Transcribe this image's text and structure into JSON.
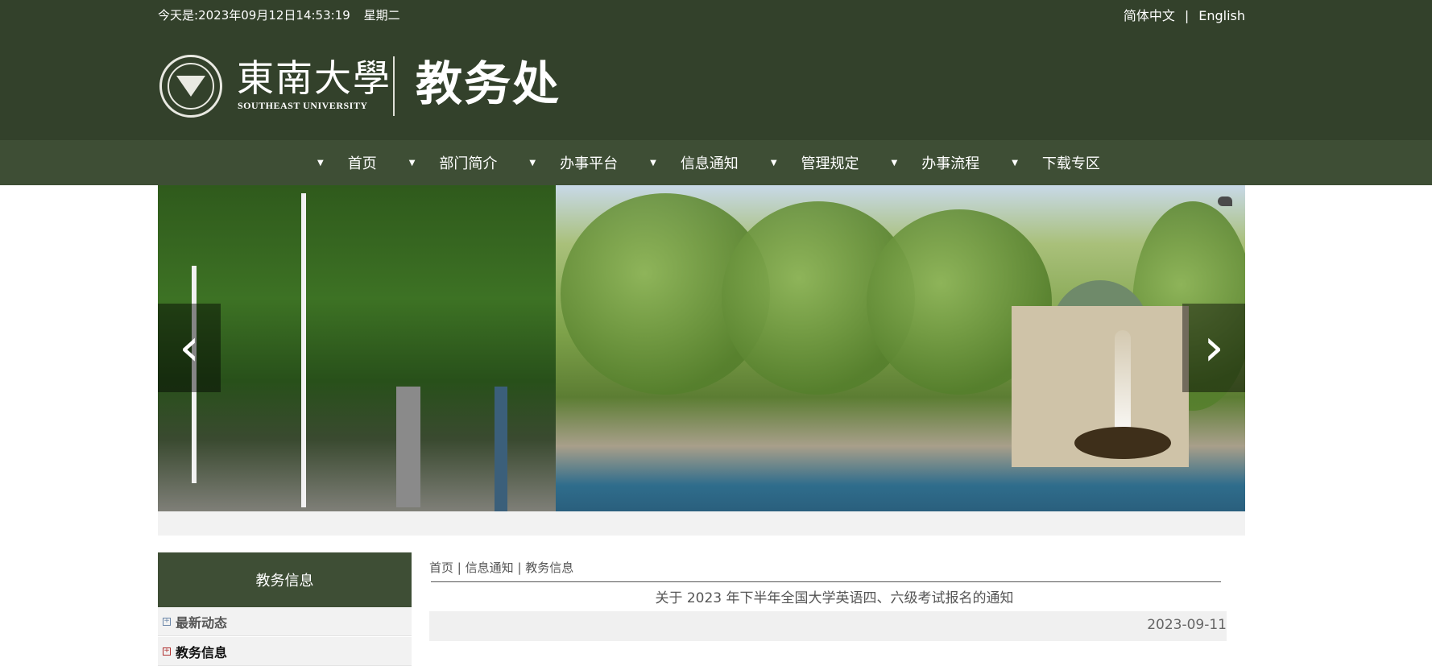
{
  "header": {
    "datetime_label": "今天是:",
    "datetime_value": "2023年09月12日14:53:19",
    "weekday": "星期二",
    "lang_cn": "简体中文",
    "lang_sep": "|",
    "lang_en": "English",
    "school_name_cn": "東南大學",
    "school_name_en": "SOUTHEAST UNIVERSITY",
    "office_name": "教务处"
  },
  "nav": {
    "arrow": "▼",
    "items": [
      {
        "label": "首页"
      },
      {
        "label": "部门简介"
      },
      {
        "label": "办事平台"
      },
      {
        "label": "信息通知"
      },
      {
        "label": "管理规定"
      },
      {
        "label": "办事流程"
      },
      {
        "label": "下载专区"
      }
    ]
  },
  "banner": {
    "prev_glyph": "‹",
    "next_glyph": "›"
  },
  "sidebar": {
    "title": "教务信息",
    "items": [
      {
        "label": "最新动态",
        "marker": "+"
      },
      {
        "label": "教务信息",
        "marker": "+"
      }
    ]
  },
  "article": {
    "breadcrumb": [
      "首页",
      "信息通知",
      "教务信息"
    ],
    "breadcrumb_sep": "|",
    "title": "关于 2023 年下半年全国大学英语四、六级考试报名的通知",
    "date": "2023-09-11"
  }
}
